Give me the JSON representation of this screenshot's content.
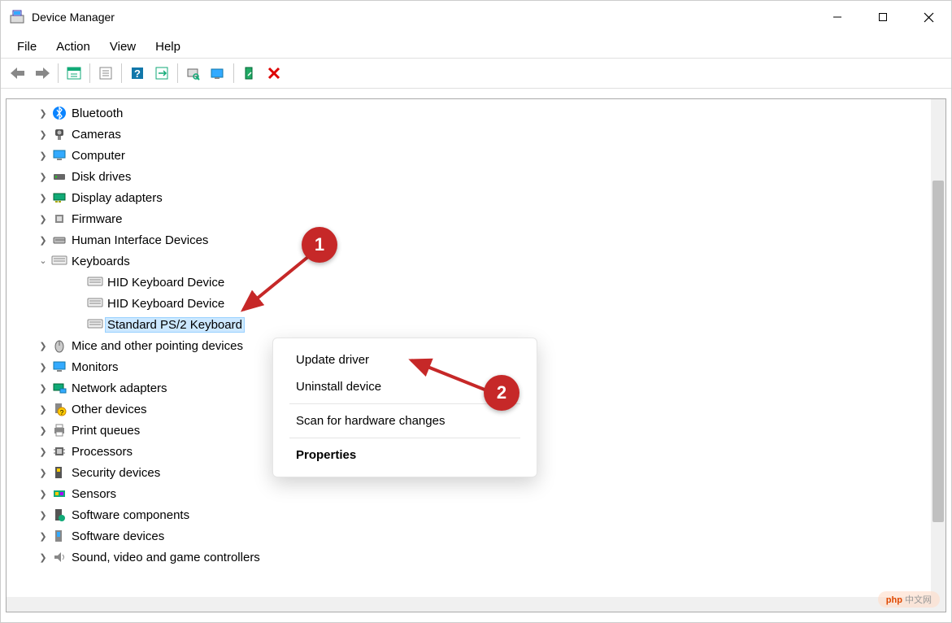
{
  "window": {
    "title": "Device Manager"
  },
  "menubar": {
    "file": "File",
    "action": "Action",
    "view": "View",
    "help": "Help"
  },
  "tree": {
    "bluetooth": "Bluetooth",
    "cameras": "Cameras",
    "computer": "Computer",
    "disk_drives": "Disk drives",
    "display_adapters": "Display adapters",
    "firmware": "Firmware",
    "hid": "Human Interface Devices",
    "keyboards": "Keyboards",
    "keyboards_children": {
      "hid1": "HID Keyboard Device",
      "hid2": "HID Keyboard Device",
      "standard": "Standard PS/2 Keyboard"
    },
    "mice": "Mice and other pointing devices",
    "monitors": "Monitors",
    "network": "Network adapters",
    "other": "Other devices",
    "print_queues": "Print queues",
    "processors": "Processors",
    "security": "Security devices",
    "sensors": "Sensors",
    "software_components": "Software components",
    "software_devices": "Software devices",
    "sound": "Sound, video and game controllers"
  },
  "context_menu": {
    "update_driver": "Update driver",
    "uninstall_device": "Uninstall device",
    "scan_hardware": "Scan for hardware changes",
    "properties": "Properties"
  },
  "callouts": {
    "one": "1",
    "two": "2"
  },
  "watermark": {
    "brand": "php",
    "text": " 中文网"
  }
}
